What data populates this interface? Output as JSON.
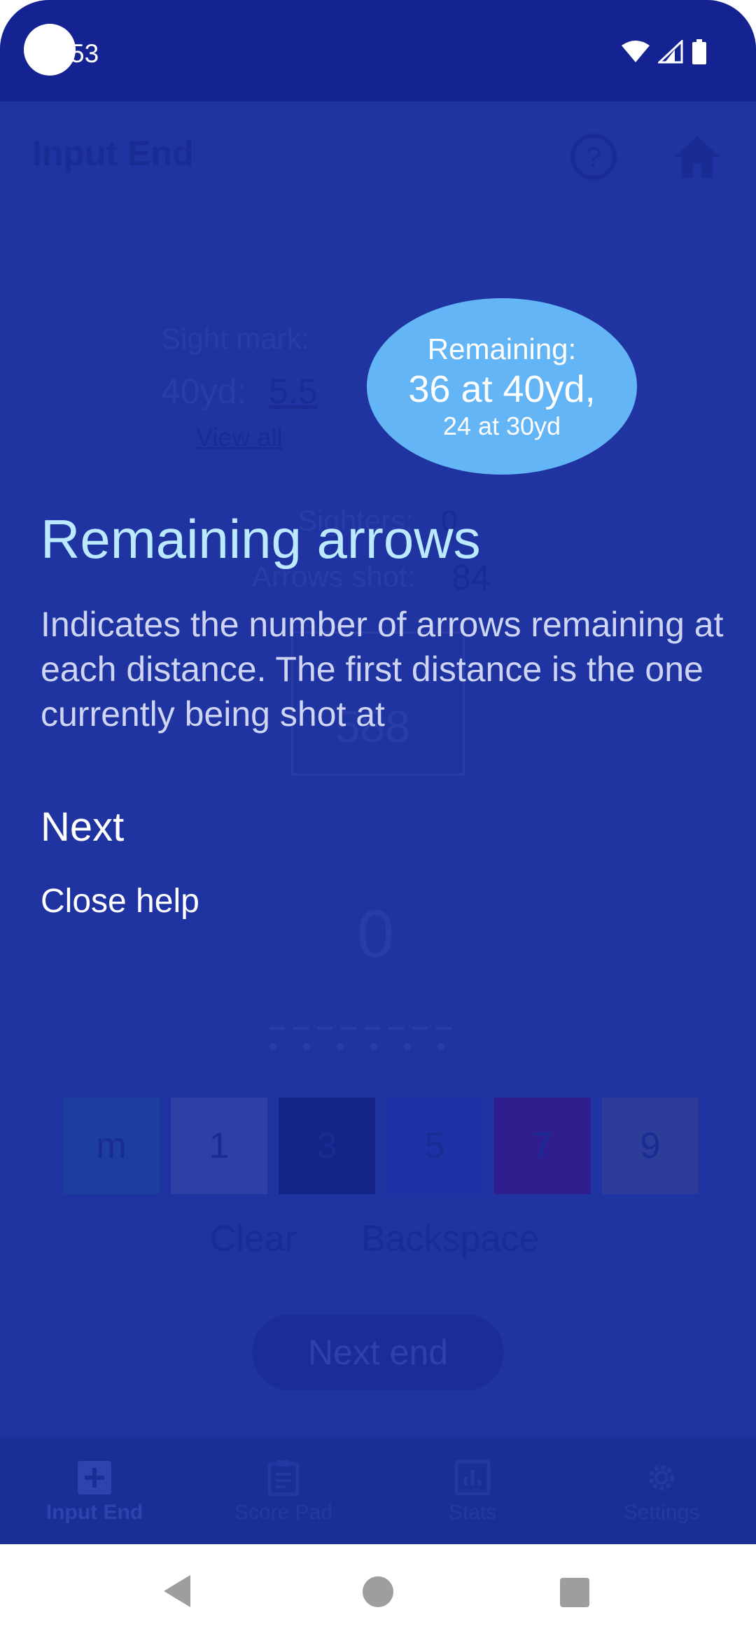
{
  "status_bar": {
    "time": "53"
  },
  "topbar": {
    "title": "Input End"
  },
  "sight": {
    "label": "Sight mark:",
    "distance": "40yd:",
    "value": "5.5",
    "view_all": "View all"
  },
  "counts": {
    "sighters_label": "Sighters:",
    "sighters_value": "0",
    "arrows_shot_label": "Arrows shot:",
    "arrows_shot_value": "84"
  },
  "score_box": {
    "value": "588"
  },
  "end_total": "0",
  "keypad": {
    "keys": [
      "m",
      "1",
      "3",
      "5",
      "7",
      "9"
    ],
    "colors": [
      "#1d3e9e",
      "#2e3fa5",
      "#152487",
      "#1c32a5",
      "#301e8f",
      "#2d3b99"
    ]
  },
  "actions": {
    "clear": "Clear",
    "backspace": "Backspace",
    "next_end": "Next end"
  },
  "bottom_nav": [
    {
      "label": "Input End",
      "icon": "plus-box-icon"
    },
    {
      "label": "Score Pad",
      "icon": "clipboard-icon"
    },
    {
      "label": "Stats",
      "icon": "bar-chart-icon"
    },
    {
      "label": "Settings",
      "icon": "gear-icon"
    }
  ],
  "remaining_bubble": {
    "line1": "Remaining:",
    "line2": "36 at 40yd,",
    "line3": "24 at 30yd"
  },
  "tutorial": {
    "title": "Remaining arrows",
    "body": "Indicates the number of arrows remaining at each distance. The first distance is the one currently being shot at",
    "next": "Next",
    "close": "Close help"
  },
  "colors": {
    "overlay": "#1f34a0",
    "status_bar": "#142391",
    "bubble": "#64b5f6",
    "title": "#bbe9ff"
  }
}
